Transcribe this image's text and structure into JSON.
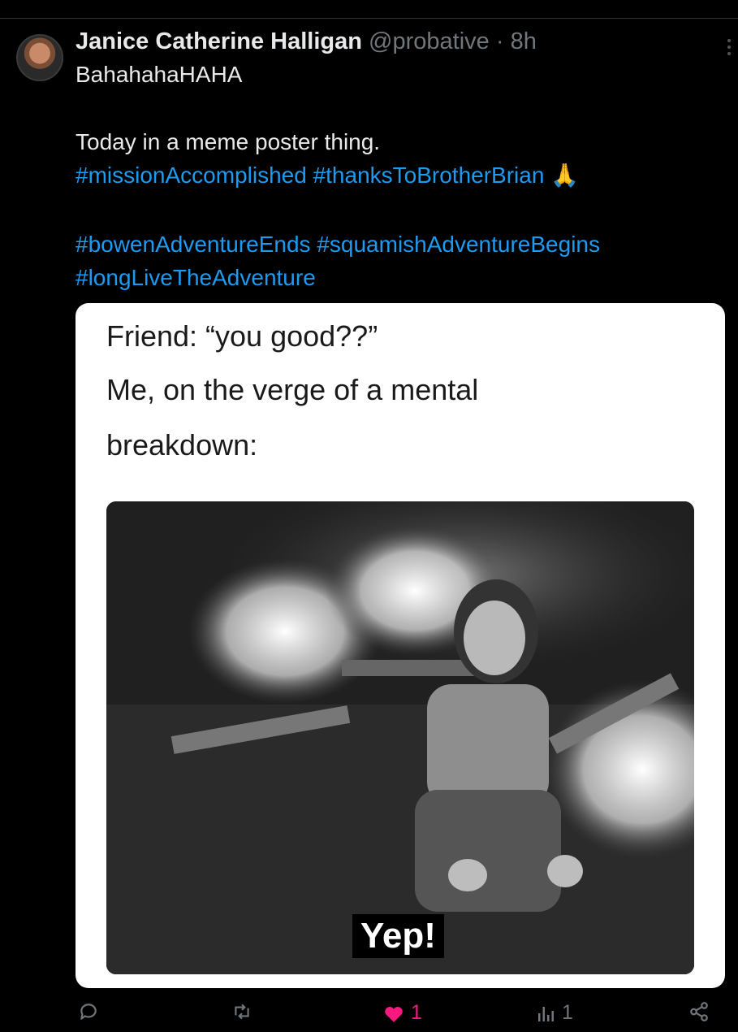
{
  "post": {
    "author_name": "Janice Catherine Halligan",
    "handle": "@probative",
    "separator": "·",
    "time": "8h",
    "lines": {
      "l1": "BahahahaHAHA",
      "l2": "Today in a meme poster thing.",
      "l3_tag1": "#missionAccomplished",
      "l3_tag2": "#thanksToBrotherBrian",
      "l3_emoji": "🙏",
      "l4_tag1": "#bowenAdventureEnds",
      "l4_tag2": "#squamishAdventureBegins",
      "l5_tag1": "#longLiveTheAdventure"
    },
    "meme": {
      "line1": "Friend: “you good??”",
      "line2": "Me, on the verge of a mental",
      "line3": "breakdown:",
      "caption": "Yep!"
    }
  },
  "actions": {
    "likes": "1",
    "views": "1"
  },
  "colors": {
    "accent": "#1d9bf0",
    "like": "#f91880",
    "muted": "#71767b"
  }
}
